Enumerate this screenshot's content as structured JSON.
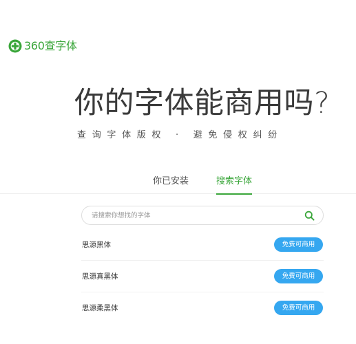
{
  "logo": {
    "text": "360查字体",
    "color": "#3aa63a"
  },
  "hero": {
    "title": "你的字体能商用吗?",
    "subtitle": "查询字体版权 · 避免侵权纠纷"
  },
  "tabs": [
    {
      "label": "你已安装",
      "active": false
    },
    {
      "label": "搜索字体",
      "active": true
    }
  ],
  "search": {
    "placeholder": "请搜索你想找的字体",
    "value": ""
  },
  "fonts": [
    {
      "name": "思源黑体",
      "status": "免费可商用"
    },
    {
      "name": "思源真黑体",
      "status": "免费可商用"
    },
    {
      "name": "思源柔黑体",
      "status": "免费可商用"
    }
  ],
  "colors": {
    "accent": "#3aa63a",
    "button": "#35a7f0"
  }
}
